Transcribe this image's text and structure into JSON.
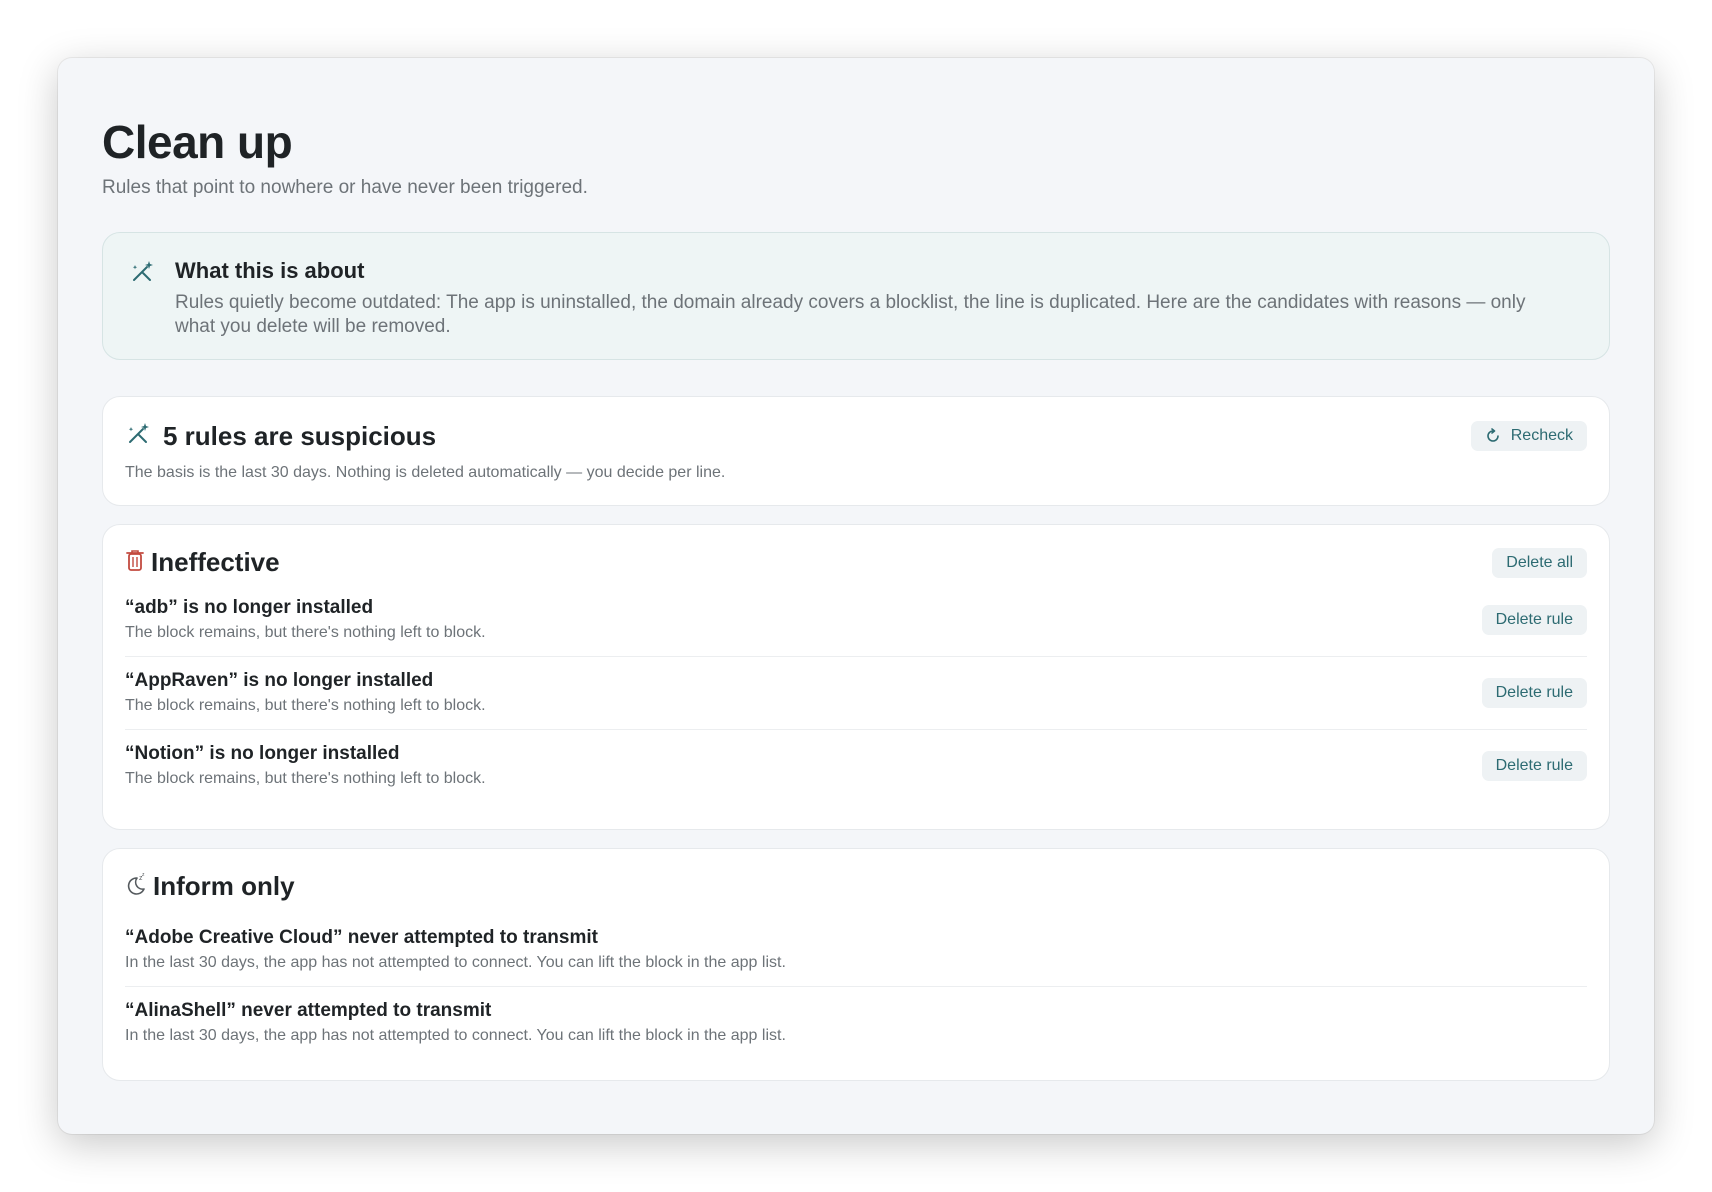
{
  "header": {
    "title": "Clean up",
    "subtitle": "Rules that point to nowhere or have never been triggered."
  },
  "info": {
    "icon": "magic-wand-icon",
    "title": "What this is about",
    "text": "Rules quietly become outdated: The app is uninstalled, the domain already covers a blocklist, the line is duplicated. Here are the candidates with reasons — only what you delete will be removed."
  },
  "summary": {
    "icon": "magic-wand-icon",
    "title": "5 rules are suspicious",
    "text": "The basis is the last 30 days. Nothing is deleted automatically — you decide per line.",
    "recheck_label": "Recheck"
  },
  "ineffective": {
    "icon": "trash-icon",
    "title": "Ineffective",
    "delete_all_label": "Delete all",
    "items": [
      {
        "title": "“adb” is no longer installed",
        "text": "The block remains, but there's nothing left to block.",
        "action": "Delete rule"
      },
      {
        "title": "“AppRaven” is no longer installed",
        "text": "The block remains, but there's nothing left to block.",
        "action": "Delete rule"
      },
      {
        "title": "“Notion” is no longer installed",
        "text": "The block remains, but there's nothing left to block.",
        "action": "Delete rule"
      }
    ]
  },
  "inform": {
    "icon": "moon-sleep-icon",
    "title": "Inform only",
    "items": [
      {
        "title": "“Adobe Creative Cloud” never attempted to transmit",
        "text": "In the last 30 days, the app has not attempted to connect. You can lift the block in the app list."
      },
      {
        "title": "“AlinaShell” never attempted to transmit",
        "text": "In the last 30 days, the app has not attempted to connect. You can lift the block in the app list."
      }
    ]
  },
  "colors": {
    "accent": "#2d6b72",
    "danger": "#c24a3f",
    "window_bg": "#f4f6f9",
    "info_bg": "#eef5f5"
  }
}
